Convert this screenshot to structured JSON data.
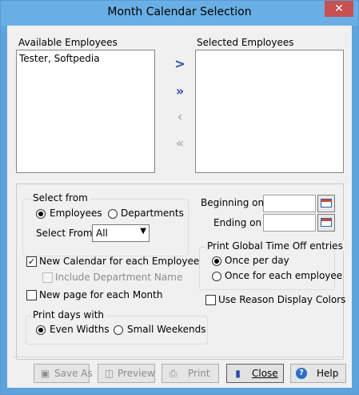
{
  "window": {
    "title": "Month Calendar Selection",
    "close_glyph": "✕"
  },
  "available": {
    "label": "Available Employees",
    "items": [
      "Tester, Softpedia"
    ]
  },
  "selected": {
    "label": "Selected Employees",
    "items": []
  },
  "move_buttons": {
    "add_one": ">",
    "add_all": "»",
    "remove_one": "‹",
    "remove_all": "«"
  },
  "select_from_group": {
    "title": "Select from",
    "employees": "Employees",
    "departments": "Departments",
    "selected_option": "Employees",
    "select_from_label": "Select From",
    "select_from_value": "All"
  },
  "new_calendar": {
    "label": "New Calendar for each Employee",
    "checked": true
  },
  "include_department": {
    "label": "Include Department Name",
    "checked": false,
    "enabled": false
  },
  "new_page": {
    "label": "New page for each Month",
    "checked": false
  },
  "print_days_group": {
    "title": "Print days with",
    "even": "Even Widths",
    "small": "Small Weekends",
    "selected_option": "Even Widths"
  },
  "beginning": {
    "label": "Beginning on",
    "value": ""
  },
  "ending": {
    "label": "Ending on",
    "value": ""
  },
  "global_timeoff_group": {
    "title": "Print Global Time Off entries",
    "once_per_day": "Once per day",
    "once_each_employee": "Once for each employee",
    "selected_option": "Once per day"
  },
  "reason_colors": {
    "label": "Use Reason Display Colors",
    "checked": false
  },
  "footer": {
    "save_as": "Save As",
    "preview": "Preview",
    "print": "Print",
    "close": "Close",
    "help": "Help"
  },
  "icons": {
    "save": "save-icon",
    "preview": "preview-icon",
    "print": "printer-icon",
    "close": "close-door-icon",
    "help": "help-icon",
    "calendar": "calendar-icon"
  },
  "colors": {
    "titlebar": "#69afe5",
    "close_button": "#c75050",
    "accent": "#2a4ea8"
  }
}
